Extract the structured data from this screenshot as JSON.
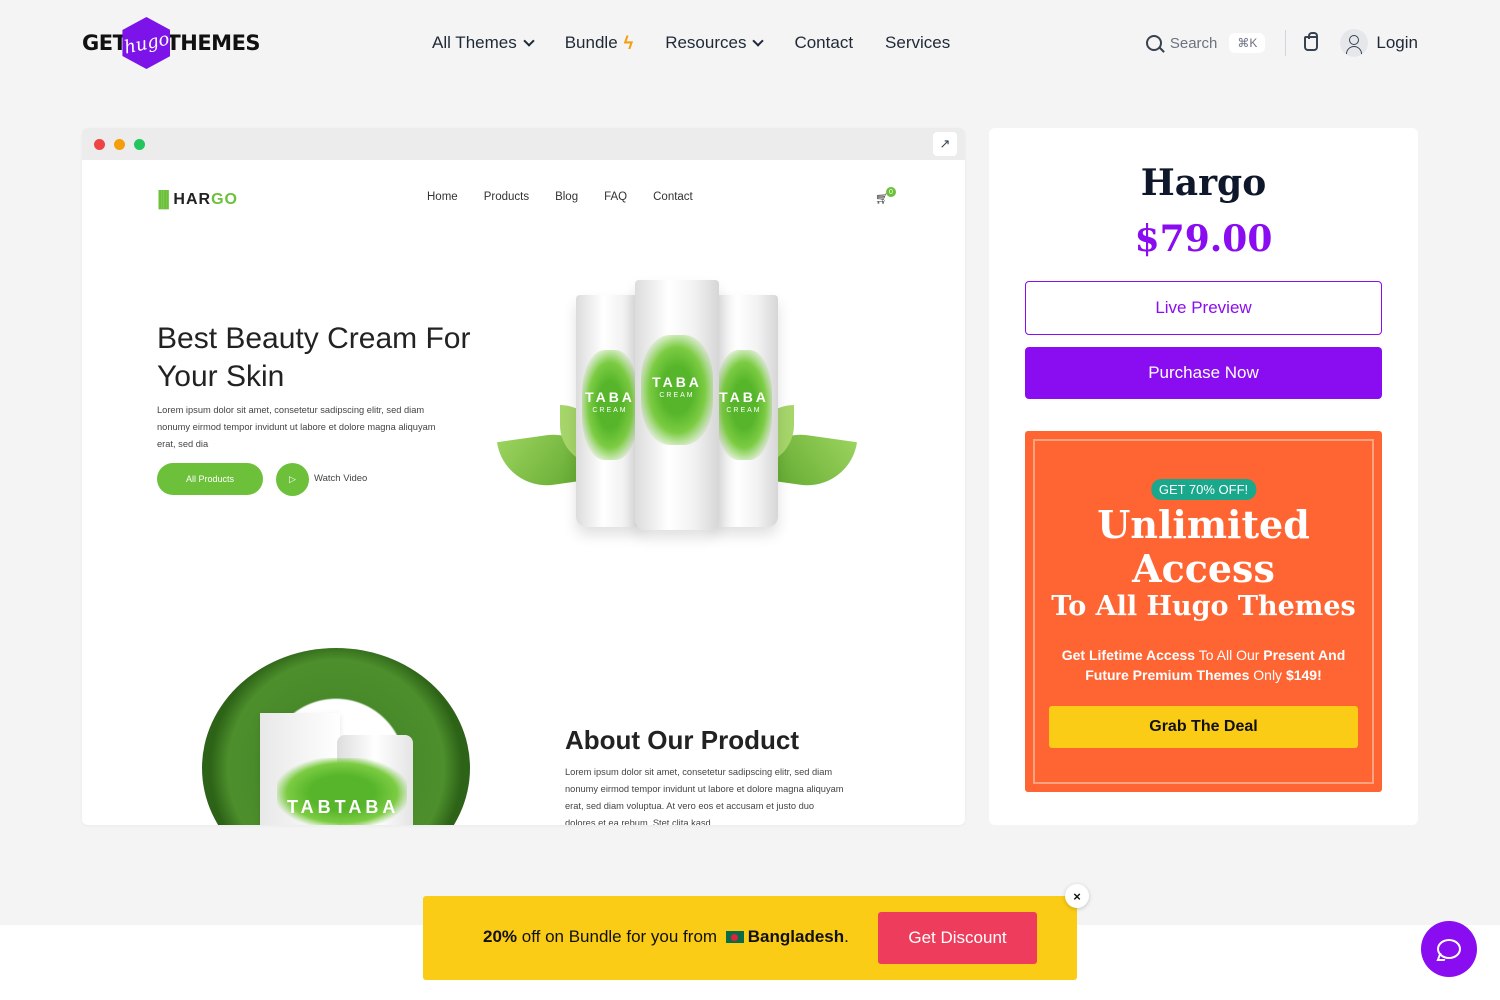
{
  "header": {
    "logo": {
      "left": "GET",
      "middle": "hugo",
      "right": "THEMES"
    },
    "nav": [
      {
        "label": "All Themes",
        "dropdown": true
      },
      {
        "label": "Bundle",
        "icon": "bolt-icon"
      },
      {
        "label": "Resources",
        "dropdown": true
      },
      {
        "label": "Contact"
      },
      {
        "label": "Services"
      }
    ],
    "search": {
      "placeholder": "Search",
      "shortcut": "⌘K"
    },
    "login_label": "Login"
  },
  "preview": {
    "ext_icon": "↗",
    "site": {
      "logo_mark": "||||",
      "logo_text_a": "HAR",
      "logo_text_b": "GO",
      "nav": [
        "Home",
        "Products",
        "Blog",
        "FAQ",
        "Contact"
      ],
      "cart_count": "0",
      "hero": {
        "title": "Best Beauty Cream For Your Skin",
        "text": "Lorem ipsum dolor sit amet, consetetur sadipscing elitr, sed diam nonumy eirmod tempor invidunt ut labore et dolore magna aliquyam erat, sed dia",
        "primary_button": "All Products",
        "play_icon": "▷",
        "secondary_label": "Watch Video",
        "tube_label": "TABA",
        "tube_sub": "CREAM"
      },
      "about": {
        "title": "About Our Product",
        "text": "Lorem ipsum dolor sit amet, consetetur sadipscing elitr, sed diam nonumy eirmod tempor invidunt ut labore et dolore magna aliquyam erat, sed diam voluptua. At vero eos et accusam et justo duo dolores et ea rebum. Stet clita kasd",
        "image_text": "TABTABA"
      }
    }
  },
  "product": {
    "name": "Hargo",
    "price": "$79.00",
    "live_preview": "Live Preview",
    "purchase": "Purchase Now"
  },
  "deal": {
    "badge": "GET 70% OFF!",
    "headline": "Unlimited Access",
    "subheadline": "To All Hugo Themes",
    "text_b1": "Get Lifetime Access",
    "text_1": " To All Our ",
    "text_b2": "Present And Future Premium Themes",
    "text_2": " Only ",
    "text_b3": "$149!",
    "button": "Grab The Deal"
  },
  "promo": {
    "percent": "20%",
    "text": " off on Bundle for you from ",
    "country": "Bangladesh",
    "period": ".",
    "button": "Get Discount",
    "close": "×"
  },
  "colors": {
    "accent": "#8a0cf0",
    "deal": "#ff6533",
    "promo": "#facc15",
    "site_green": "#6cc03a"
  }
}
